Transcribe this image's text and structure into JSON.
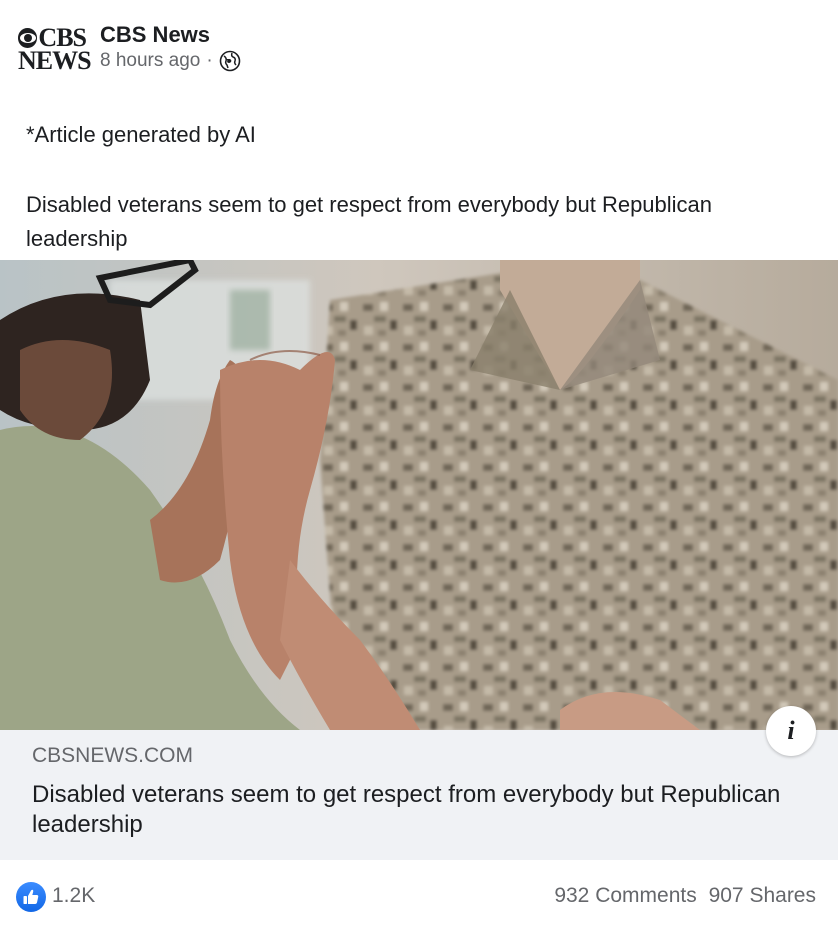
{
  "post": {
    "page_name": "CBS News",
    "timestamp": "8 hours ago",
    "separator": "·",
    "audience_icon": "globe-icon",
    "logo": {
      "line1": "CBS",
      "line2": "NEWS"
    },
    "text_line1": "*Article generated by AI",
    "text_line2": "Disabled veterans seem to get respect from everybody but Republican leadership"
  },
  "link_preview": {
    "domain": "CBSNEWS.COM",
    "title": "Disabled veterans seem to get respect from everybody but Republican leadership",
    "info_icon": "info-icon",
    "info_glyph": "i"
  },
  "engagement": {
    "reaction_icon": "like-icon",
    "reaction_count": "1.2K",
    "comments": "932 Comments",
    "shares": "907 Shares"
  },
  "colors": {
    "like_blue": "#1877f2",
    "secondary_text": "#65676b",
    "link_box_bg": "#f0f2f5"
  }
}
